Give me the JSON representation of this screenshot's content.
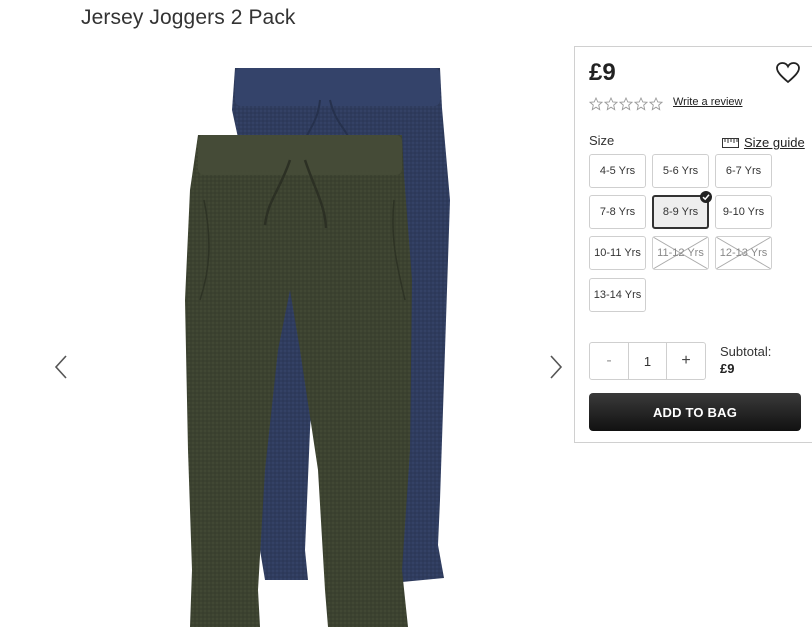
{
  "product": {
    "title": "Jersey Joggers 2 Pack",
    "price": "£9",
    "rating_stars": 0,
    "review_link": "Write a review"
  },
  "gallery": {
    "prev_icon": "chevron-left-icon",
    "next_icon": "chevron-right-icon",
    "image_description": "two pairs of jogger trousers, navy and khaki"
  },
  "sizes": {
    "label": "Size",
    "guide_label": "Size guide",
    "options": [
      {
        "label": "4-5 Yrs",
        "state": "available"
      },
      {
        "label": "5-6 Yrs",
        "state": "available"
      },
      {
        "label": "6-7 Yrs",
        "state": "available"
      },
      {
        "label": "7-8 Yrs",
        "state": "available"
      },
      {
        "label": "8-9 Yrs",
        "state": "selected"
      },
      {
        "label": "9-10 Yrs",
        "state": "available"
      },
      {
        "label": "10-11 Yrs",
        "state": "available"
      },
      {
        "label": "11-12 Yrs",
        "state": "unavailable"
      },
      {
        "label": "12-13 Yrs",
        "state": "unavailable"
      },
      {
        "label": "13-14 Yrs",
        "state": "available"
      }
    ]
  },
  "quantity": {
    "minus": "-",
    "value": "1",
    "plus": "+"
  },
  "subtotal": {
    "label": "Subtotal:",
    "value": "£9"
  },
  "actions": {
    "add_to_bag": "ADD TO BAG"
  },
  "colors": {
    "navy": "#2d3a5c",
    "khaki": "#3d4230",
    "button_dark": "#1f1f1f"
  }
}
